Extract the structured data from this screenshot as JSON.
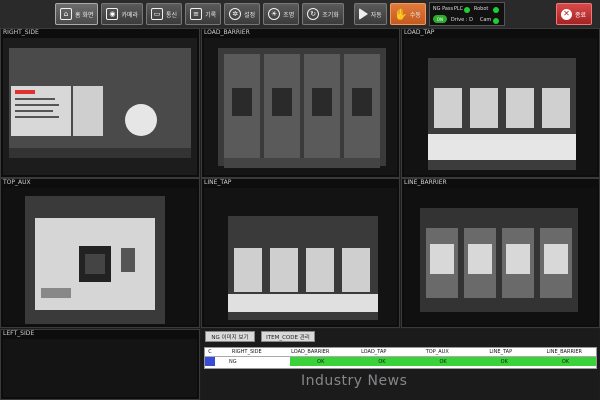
{
  "toolbar": {
    "home_label": "홈 화면",
    "camera_label": "카메라",
    "comm_label": "통신",
    "record_label": "기록",
    "settings_label": "설정",
    "lighting_label": "조명",
    "adjust_label": "조기화",
    "auto_label": "자동",
    "manual_label": "수동",
    "exit_label": "종료"
  },
  "status": {
    "ng_pass": "NG Pass",
    "toggle": "ON",
    "plc": "PLC",
    "robot": "Robot",
    "drive": "Drive : D",
    "cam": "Cam",
    "colors": {
      "ok": "#22cc33",
      "err": "#e03030"
    }
  },
  "panels": {
    "right_side": "RIGHT_SIDE",
    "load_barrier": "LOAD_BARRIER",
    "load_tap": "LOAD_TAP",
    "top_aux": "TOP_AUX",
    "line_tap": "LINE_TAP",
    "line_barrier": "LINE_BARRIER",
    "left_side": "LEFT_SIDE"
  },
  "bottom": {
    "ng_view_button": "NG 이미지 보기",
    "item_code_button": "ITEM_CODE 관리"
  },
  "results": {
    "headers": [
      "C",
      "RIGHT_SIDE",
      "LOAD_BARRIER",
      "LOAD_TAP",
      "TOP_AUX",
      "LINE_TAP",
      "LINE_BARRIER"
    ],
    "row": [
      "",
      "NG",
      "OK",
      "OK",
      "OK",
      "OK",
      "OK"
    ]
  },
  "watermark": {
    "main": "Industry News"
  }
}
